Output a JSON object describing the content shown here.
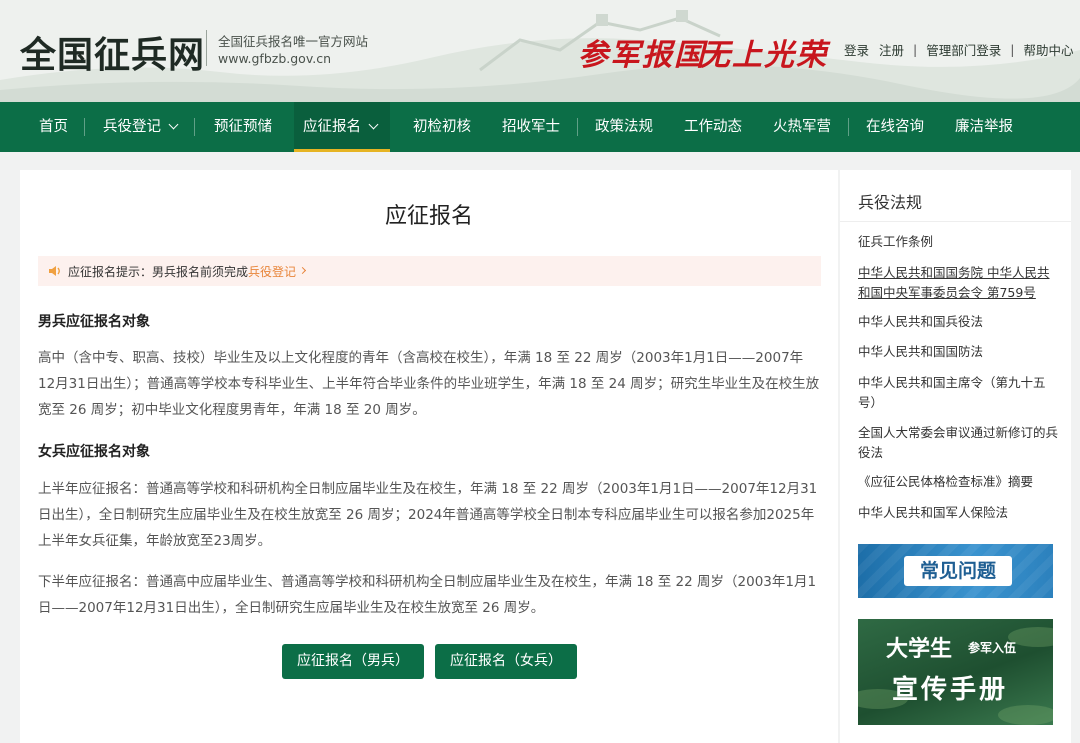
{
  "header": {
    "site_title": "全国征兵网",
    "subtitle": "全国征兵报名唯一官方网站",
    "domain": "www.gfbzb.gov.cn",
    "slogan_1": "参军报国",
    "slogan_2": "无上光荣",
    "links": {
      "login": "登录",
      "register": "注册",
      "sep": "|",
      "admin_login": "管理部门登录",
      "help": "帮助中心"
    }
  },
  "nav": {
    "items": [
      {
        "label": "首页"
      },
      {
        "label": "兵役登记"
      },
      {
        "label": "预征预储"
      },
      {
        "label": "应征报名"
      },
      {
        "label": "初检初核"
      },
      {
        "label": "招收军士"
      },
      {
        "label": "政策法规"
      },
      {
        "label": "工作动态"
      },
      {
        "label": "火热军营"
      },
      {
        "label": "在线咨询"
      },
      {
        "label": "廉洁举报"
      }
    ],
    "active_index": 3
  },
  "main": {
    "title": "应征报名",
    "notice": {
      "text": "应征报名提示：男兵报名前须完成",
      "link": "兵役登记"
    },
    "male_section": {
      "title": "男兵应征报名对象",
      "paragraph": "高中（含中专、职高、技校）毕业生及以上文化程度的青年（含高校在校生），年满 18 至 22 周岁（2003年1月1日——2007年12月31日出生）；普通高等学校本专科毕业生、上半年符合毕业条件的毕业班学生，年满 18 至 24 周岁；研究生毕业生及在校生放宽至 26 周岁；初中毕业文化程度男青年，年满 18 至 20 周岁。"
    },
    "female_section": {
      "title": "女兵应征报名对象",
      "paragraph_1": "上半年应征报名：普通高等学校和科研机构全日制应届毕业生及在校生，年满 18 至 22 周岁（2003年1月1日——2007年12月31日出生），全日制研究生应届毕业生及在校生放宽至 26 周岁；2024年普通高等学校全日制本专科应届毕业生可以报名参加2025年上半年女兵征集，年龄放宽至23周岁。",
      "paragraph_2": "下半年应征报名：普通高中应届毕业生、普通高等学校和科研机构全日制应届毕业生及在校生，年满 18 至 22 周岁（2003年1月1日——2007年12月31日出生），全日制研究生应届毕业生及在校生放宽至 26 周岁。"
    },
    "buttons": {
      "male": "应征报名（男兵）",
      "female": "应征报名（女兵）"
    }
  },
  "sidebar": {
    "title": "兵役法规",
    "links": [
      "征兵工作条例",
      "中华人民共和国国务院 中华人民共和国中央军事委员会令 第759号",
      "中华人民共和国兵役法",
      "中华人民共和国国防法",
      "中华人民共和国主席令（第九十五号）",
      "全国人大常委会审议通过新修订的兵役法",
      "《应征公民体格检查标准》摘要",
      "中华人民共和国军人保险法"
    ],
    "banner_faq": "常见问题",
    "banner_book": {
      "line1": "大学生",
      "line2": "参军入伍",
      "line3": "宣传手册"
    }
  },
  "colors": {
    "nav_green": "#0c6e47",
    "active_underline": "#e6b423",
    "slogan_red": "#c8161d",
    "notice_link": "#e8853a",
    "notice_bg": "#fdf1ee"
  }
}
